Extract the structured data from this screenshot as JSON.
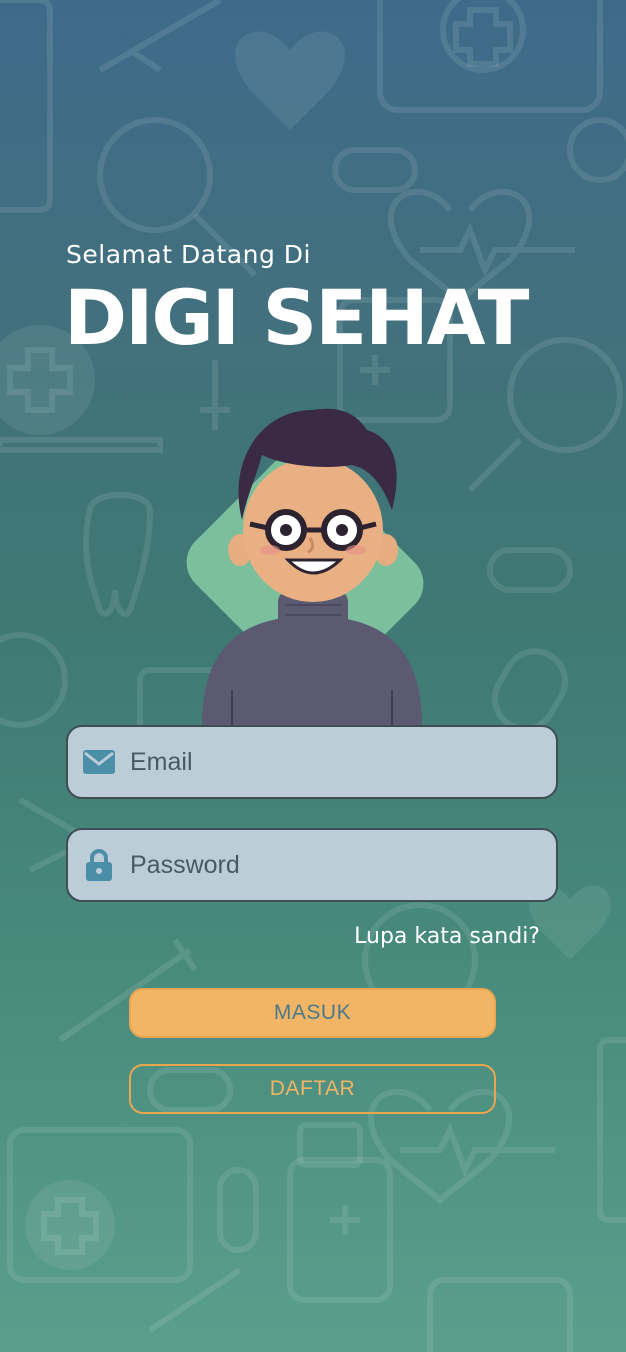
{
  "header": {
    "welcome_text": "Selamat Datang Di",
    "brand_title": "DIGI SEHAT"
  },
  "form": {
    "email_placeholder": "Email",
    "email_value": "",
    "password_placeholder": "Password",
    "password_value": "",
    "forgot_label": "Lupa kata sandi?",
    "login_label": "MASUK",
    "register_label": "DAFTAR"
  },
  "icons": {
    "email": "envelope-icon",
    "password": "lock-icon"
  },
  "colors": {
    "accent": "#f2b465",
    "field_bg": "#bccdd8",
    "icon_teal": "#4a8ea8",
    "avatar_backdrop": "#7bbf9c"
  }
}
